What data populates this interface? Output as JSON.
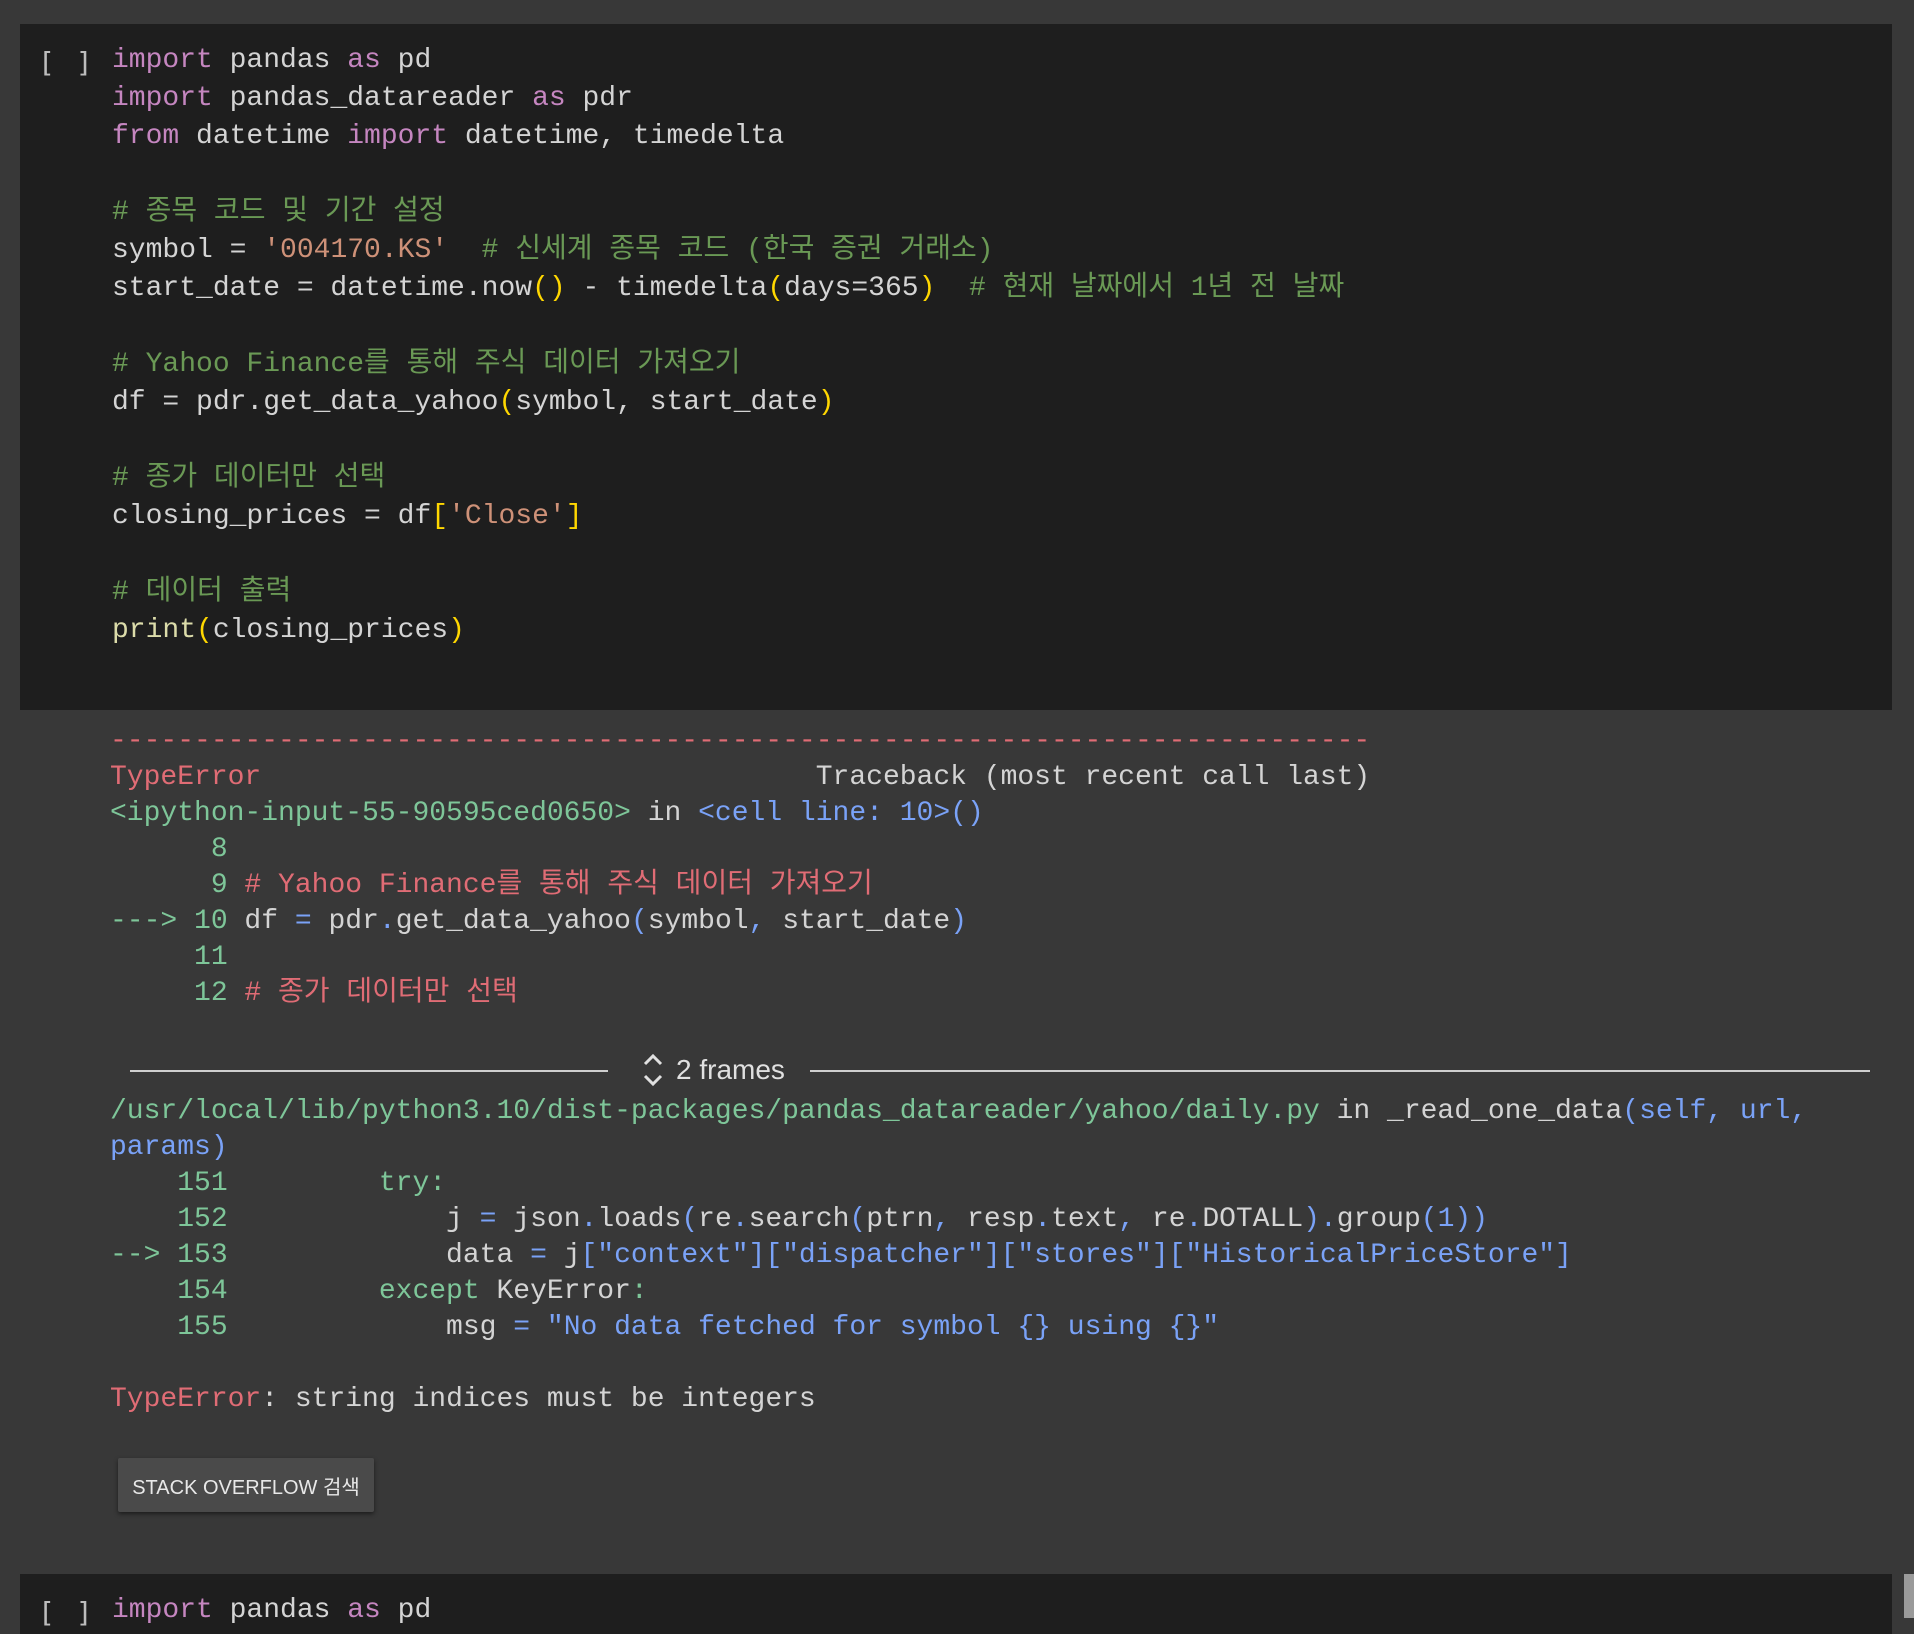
{
  "cell1": {
    "exec_indicator": "[ ]",
    "lines": {
      "l1": {
        "a": "import",
        "b": " pandas ",
        "c": "as",
        "d": " pd"
      },
      "l2": {
        "a": "import",
        "b": " pandas_datareader ",
        "c": "as",
        "d": " pdr"
      },
      "l3": {
        "a": "from",
        "b": " datetime ",
        "c": "import",
        "d": " datetime, timedelta"
      },
      "l5": "# 종목 코드 및 기간 설정",
      "l6": {
        "a": "symbol = ",
        "b": "'004170.KS'",
        "c": "  # 신세계 종목 코드 (한국 증권 거래소)"
      },
      "l7": {
        "a": "start_date = datetime.now",
        "b": "()",
        "c": " - timedelta",
        "d": "(",
        "e": "days=365",
        "f": ")",
        "g": "  # 현재 날짜에서 1년 전 날짜"
      },
      "l9": "# Yahoo Finance를 통해 주식 데이터 가져오기",
      "l10": {
        "a": "df = pdr.get_data_yahoo",
        "b": "(",
        "c": "symbol, start_date",
        "d": ")"
      },
      "l12": "# 종가 데이터만 선택",
      "l13": {
        "a": "closing_prices = df",
        "b": "[",
        "c": "'Close'",
        "d": "]"
      },
      "l15": "# 데이터 출력",
      "l16": {
        "a": "print",
        "b": "(",
        "c": "closing_prices",
        "d": ")"
      }
    }
  },
  "output": {
    "dashes": "---------------------------------------------------------------------------",
    "error_type": "TypeError",
    "traceback_label": "Traceback (most recent call last)",
    "input_ref": "<ipython-input-55-90595ced0650>",
    "in": " in ",
    "cell_line": "<cell line: 10>()",
    "t1": {
      "n8": "      8",
      "n9": "      9",
      "c9": " # Yahoo Finance를 통해 주식 데이터 가져오기",
      "arrow10": "---> 10",
      "code10a": " df ",
      "code10b": "=",
      "code10c": " pdr",
      "code10d": ".",
      "code10e": "get_data_yahoo",
      "code10f": "(",
      "code10g": "symbol",
      "code10h": ",",
      "code10i": " start_date",
      "code10j": ")",
      "n11": "     11",
      "n12": "     12",
      "c12": " # 종가 데이터만 선택"
    },
    "frames_label": "2 frames",
    "path": "/usr/local/lib/python3.10/dist-packages/pandas_datareader/yahoo/daily.py",
    "func_a": " in ",
    "func_b": "_read_one_data",
    "func_c": "(self, url,",
    "func_d": "params)",
    "t2": {
      "n151": "    151",
      "c151": "         try:",
      "n152": "    152",
      "c152a": "             j ",
      "c152b": "=",
      "c152c": " json",
      "c152d": ".",
      "c152e": "loads",
      "c152f": "(",
      "c152g": "re",
      "c152h": ".",
      "c152i": "search",
      "c152j": "(",
      "c152k": "ptrn",
      "c152l": ",",
      "c152m": " resp",
      "c152n": ".",
      "c152o": "text",
      "c152p": ",",
      "c152q": " re",
      "c152r": ".",
      "c152s": "DOTALL",
      "c152t": ").",
      "c152u": "group",
      "c152v": "(1))",
      "arrow153": "--> 153",
      "c153a": "             data ",
      "c153b": "=",
      "c153c": " j",
      "c153d": "[\"context\"][\"dispatcher\"][\"stores\"][\"HistoricalPriceStore\"]",
      "n154": "    154",
      "c154a": "         except",
      "c154b": " KeyError",
      "c154c": ":",
      "n155": "    155",
      "c155a": "             msg ",
      "c155b": "=",
      "c155c": " \"No data fetched for symbol {} using {}\""
    },
    "final_type": "TypeError",
    "final_msg": ": string indices must be integers"
  },
  "so_button_label": "STACK OVERFLOW 검색",
  "cell2": {
    "exec_indicator": "[ ]",
    "l1": {
      "a": "import",
      "b": " pandas ",
      "c": "as",
      "d": " pd"
    }
  }
}
